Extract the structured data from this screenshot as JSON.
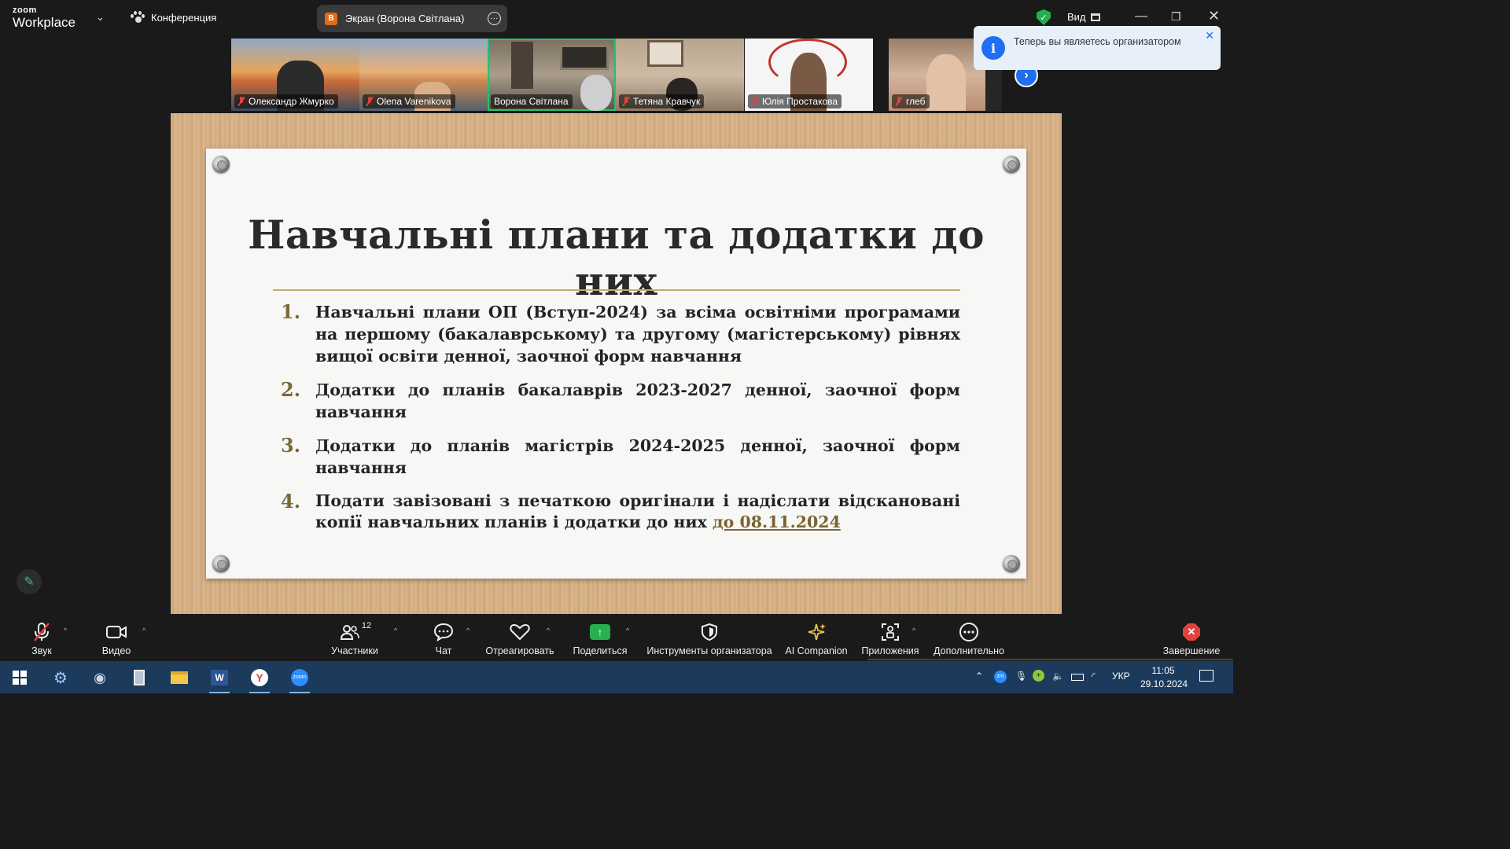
{
  "titlebar": {
    "logo_top": "zoom",
    "logo_bottom": "Workplace",
    "meeting_label": "Конференция",
    "screen_share_avatar": "В",
    "screen_share_label": "Экран (Ворона Світлана)",
    "view_label": "Вид"
  },
  "participants": [
    {
      "name": "Олександр Жмурко",
      "muted": true
    },
    {
      "name": "Olena Varenikova",
      "muted": true
    },
    {
      "name": "Ворона Світлана",
      "muted": false,
      "active_speaker": true
    },
    {
      "name": "Тетяна Кравчук",
      "muted": true
    },
    {
      "name": "Юлія Простакова",
      "muted": true
    },
    {
      "name": "глеб",
      "muted": true
    }
  ],
  "notification": {
    "text": "Теперь вы являетесь организатором"
  },
  "slide": {
    "title": "Навчальні плани та додатки до них",
    "items": [
      {
        "num": "1.",
        "text": "Навчальні плани ОП (Вступ-2024) за всіма освітніми програмами на першому (бакалаврському) та другому (магістерському) рівнях вищої освіти денної, заочної форм навчання",
        "highlight": ""
      },
      {
        "num": "2.",
        "text": "Додатки до планів бакалаврів 2023-2027 денної, заочної форм навчання",
        "highlight": ""
      },
      {
        "num": "3.",
        "text": "Додатки до планів магістрів 2024-2025 денної, заочної форм навчання",
        "highlight": ""
      },
      {
        "num": "4.",
        "text": "Подати завізовані з печаткою оригінали і надіслати відскановані копії навчальних планів і додатки до них ",
        "highlight": "до 08.11.2024"
      }
    ]
  },
  "toolbar": {
    "audio": "Звук",
    "video": "Видео",
    "participants": "Участники",
    "participants_count": "12",
    "chat": "Чат",
    "react": "Отреагировать",
    "share": "Поделиться",
    "host_tools": "Инструменты организатора",
    "ai": "AI Companion",
    "apps": "Приложения",
    "more": "Дополнительно",
    "end": "Завершение"
  },
  "taskbar": {
    "lang": "УКР",
    "time": "11:05",
    "date": "29.10.2024"
  },
  "colors": {
    "active_speaker": "#25c26a",
    "mute_red": "#e0433b",
    "share_green": "#26b14c",
    "accent_blue": "#1f6ff0",
    "slide_number": "#7a6a3a"
  }
}
